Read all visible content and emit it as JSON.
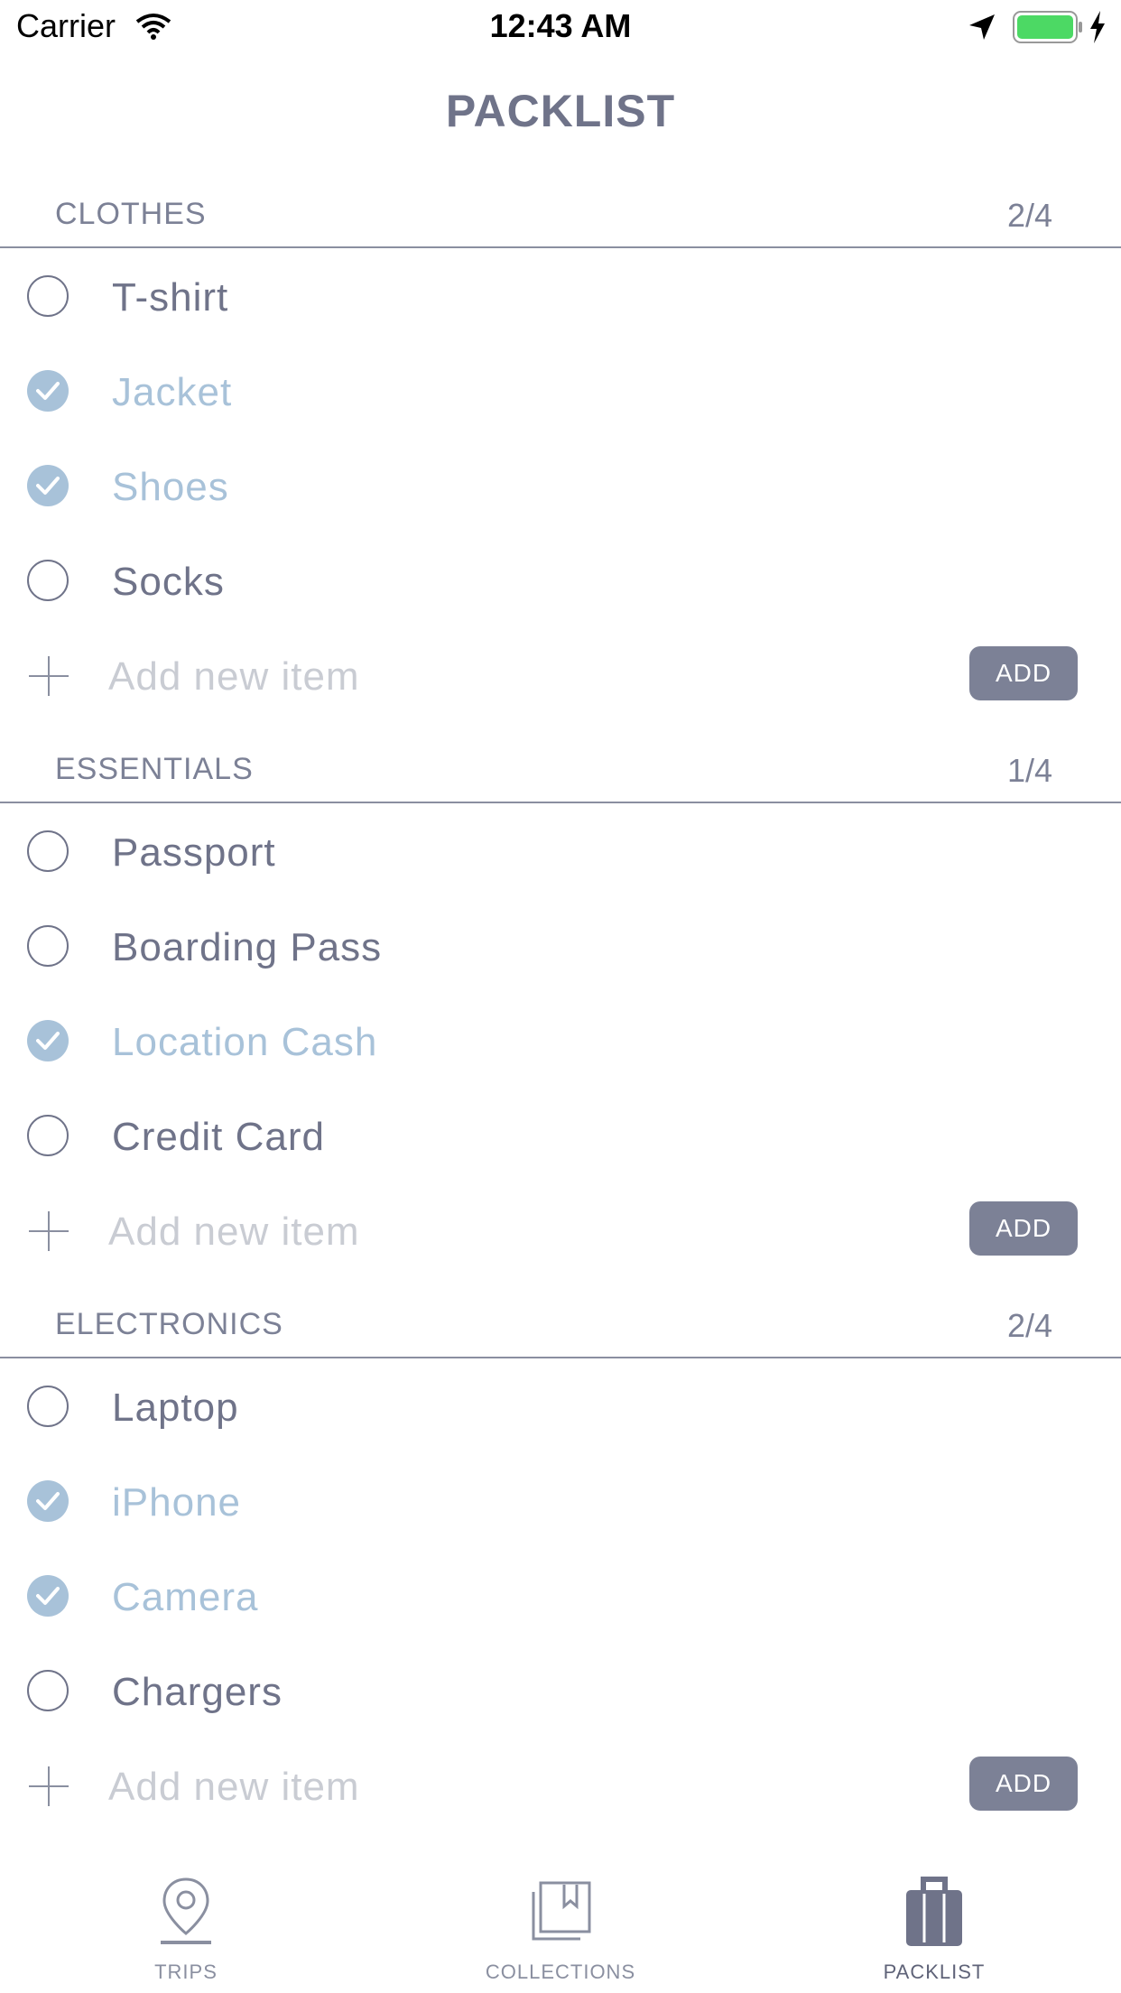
{
  "status_bar": {
    "carrier": "Carrier",
    "time": "12:43 AM"
  },
  "header": {
    "title": "PACKLIST"
  },
  "sections": [
    {
      "name": "CLOTHES",
      "count": "2/4",
      "items": [
        {
          "label": "T-shirt",
          "checked": false
        },
        {
          "label": "Jacket",
          "checked": true
        },
        {
          "label": "Shoes",
          "checked": true
        },
        {
          "label": "Socks",
          "checked": false
        }
      ],
      "add_placeholder": "Add new item",
      "add_label": "ADD"
    },
    {
      "name": "ESSENTIALS",
      "count": "1/4",
      "items": [
        {
          "label": "Passport",
          "checked": false
        },
        {
          "label": "Boarding Pass",
          "checked": false
        },
        {
          "label": "Location Cash",
          "checked": true
        },
        {
          "label": "Credit Card",
          "checked": false
        }
      ],
      "add_placeholder": "Add new item",
      "add_label": "ADD"
    },
    {
      "name": "ELECTRONICS",
      "count": "2/4",
      "items": [
        {
          "label": "Laptop",
          "checked": false
        },
        {
          "label": "iPhone",
          "checked": true
        },
        {
          "label": "Camera",
          "checked": true
        },
        {
          "label": "Chargers",
          "checked": false
        }
      ],
      "add_placeholder": "Add new item",
      "add_label": "ADD"
    }
  ],
  "tab_bar": {
    "tabs": [
      {
        "label": "TRIPS",
        "icon": "map-pin-icon",
        "active": false
      },
      {
        "label": "COLLECTIONS",
        "icon": "bookmark-album-icon",
        "active": false
      },
      {
        "label": "PACKLIST",
        "icon": "suitcase-icon",
        "active": true
      }
    ]
  },
  "colors": {
    "text": "#6f7389",
    "checked": "#a8c2d9",
    "button": "#7c8196",
    "placeholder": "#c9ccd3",
    "battery": "#4cd964"
  }
}
